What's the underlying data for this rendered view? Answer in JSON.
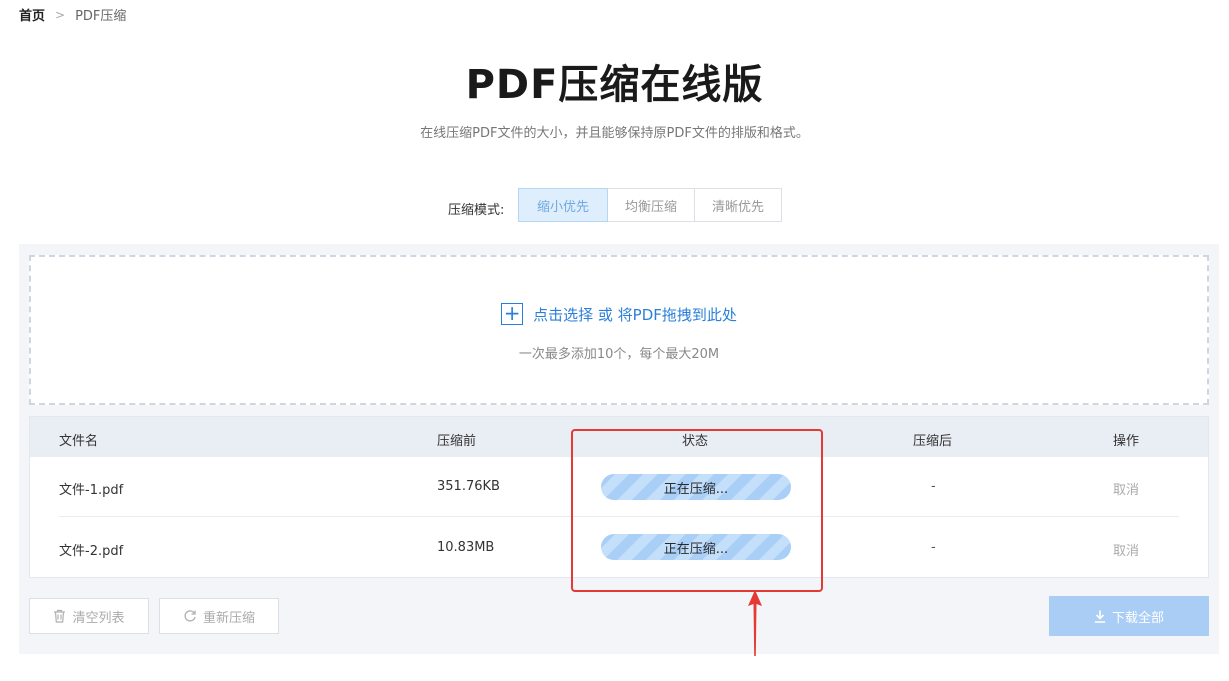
{
  "breadcrumb": {
    "home": "首页",
    "separator": ">",
    "current": "PDF压缩"
  },
  "header": {
    "title": "PDF压缩在线版",
    "subtitle": "在线压缩PDF文件的大小，并且能够保持原PDF文件的排版和格式。"
  },
  "mode": {
    "label": "压缩模式:",
    "options": [
      "缩小优先",
      "均衡压缩",
      "清晰优先"
    ],
    "selected": "缩小优先"
  },
  "upload": {
    "plus": "+",
    "prompt": "点击选择 或 将PDF拖拽到此处",
    "hint": "一次最多添加10个，每个最大20M"
  },
  "table": {
    "headers": [
      "文件名",
      "压缩前",
      "状态",
      "压缩后",
      "操作"
    ],
    "rows": [
      {
        "name": "文件-1.pdf",
        "before": "351.76KB",
        "status": "正在压缩...",
        "after": "-",
        "action": "取消"
      },
      {
        "name": "文件-2.pdf",
        "before": "10.83MB",
        "status": "正在压缩...",
        "after": "-",
        "action": "取消"
      }
    ]
  },
  "footer": {
    "clear": "清空列表",
    "recompress": "重新压缩",
    "download_all": "下载全部"
  },
  "colors": {
    "accent": "#2b7fd9",
    "highlight_box": "#e53935",
    "progress": "#a9cff6"
  },
  "icons": {
    "clear": "trash-icon",
    "recompress": "refresh-icon",
    "download": "download-icon"
  }
}
